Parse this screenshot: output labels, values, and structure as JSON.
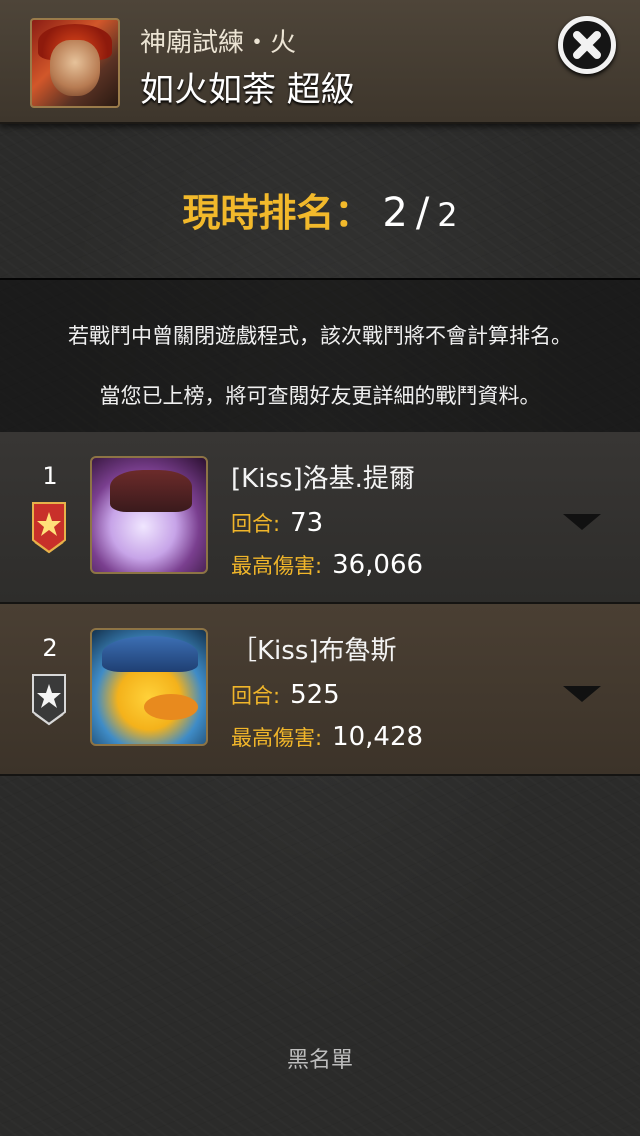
{
  "header": {
    "subtitle": "神廟試練・火",
    "title": "如火如荼 超級"
  },
  "ranking": {
    "label": "現時排名：",
    "current": "2",
    "separator": "/",
    "total": "2"
  },
  "notice": {
    "line1": "若戰鬥中曾關閉遊戲程式，該次戰鬥將不會計算排名。",
    "line2": "當您已上榜，將可查閱好友更詳細的戰鬥資料。"
  },
  "players": [
    {
      "rank": "1",
      "name": "[Kiss]洛基.提爾",
      "rounds_label": "回合:",
      "rounds": "73",
      "damage_label": "最高傷害:",
      "damage": "36,066",
      "medal_color": "#c8302a"
    },
    {
      "rank": "2",
      "name": "［Kiss]布魯斯",
      "rounds_label": "回合:",
      "rounds": "525",
      "damage_label": "最高傷害:",
      "damage": "10,428",
      "medal_color": "#3a3a3a"
    }
  ],
  "footer": {
    "blacklist_label": "黑名單"
  },
  "icons": {
    "close": "close-icon",
    "medal_gold": "medal-star-icon",
    "expand": "chevron-down-icon"
  }
}
